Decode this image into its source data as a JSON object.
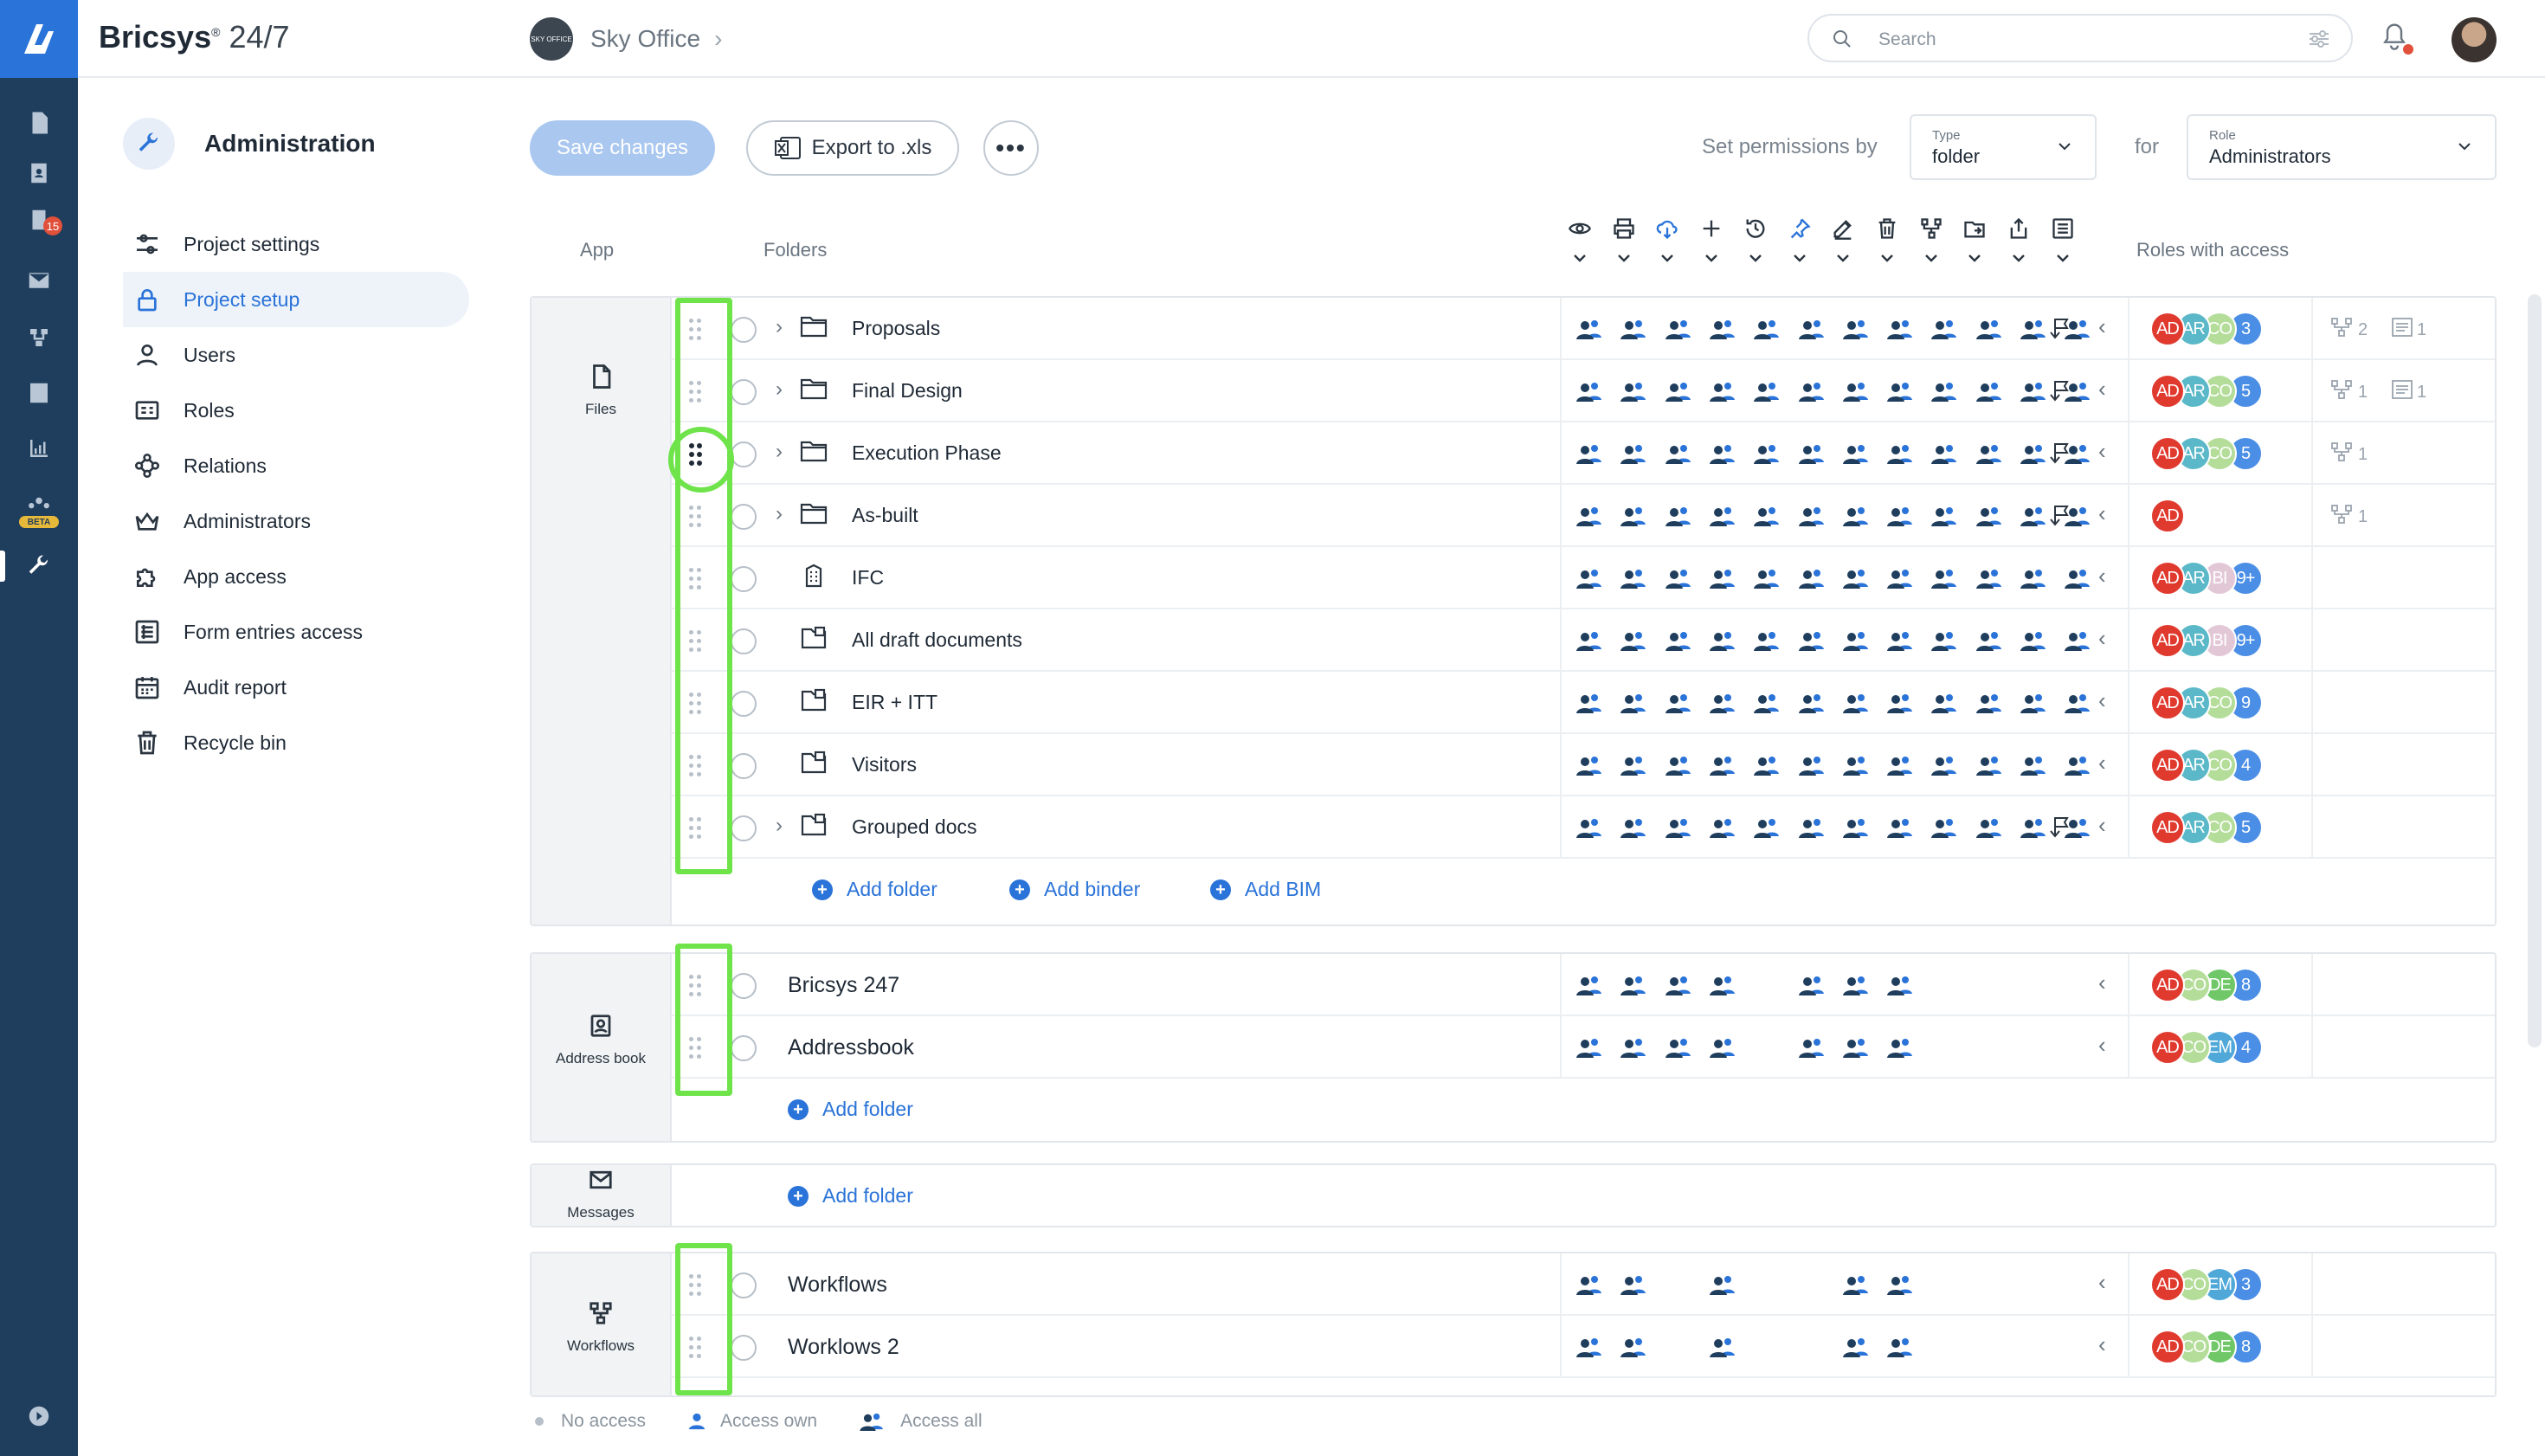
{
  "app": {
    "brand": "Bricsys",
    "brand_sup": "®",
    "brand_version": "24/7"
  },
  "project": {
    "logo_text": "SKY OFFICE",
    "name": "Sky Office",
    "chevron": "›"
  },
  "search": {
    "placeholder": "Search"
  },
  "admin": {
    "title": "Administration"
  },
  "nav": [
    {
      "label": "Project settings",
      "icon": "sliders-icon"
    },
    {
      "label": "Project setup",
      "icon": "lock-icon",
      "active": true
    },
    {
      "label": "Users",
      "icon": "user-icon"
    },
    {
      "label": "Roles",
      "icon": "id-card-icon"
    },
    {
      "label": "Relations",
      "icon": "relations-icon"
    },
    {
      "label": "Administrators",
      "icon": "crown-icon"
    },
    {
      "label": "App access",
      "icon": "puzzle-icon"
    },
    {
      "label": "Form entries access",
      "icon": "form-icon"
    },
    {
      "label": "Audit report",
      "icon": "calendar-icon"
    },
    {
      "label": "Recycle bin",
      "icon": "trash-icon"
    }
  ],
  "rail": {
    "messages_badge": "15",
    "beta_label": "BETA"
  },
  "toolbar": {
    "save_label": "Save changes",
    "export_label": "Export to .xls",
    "more_label": "•••",
    "set_permissions_label": "Set permissions by",
    "type_select": {
      "label": "Type",
      "value": "folder"
    },
    "for_label": "for",
    "role_select": {
      "label": "Role",
      "value": "Administrators"
    }
  },
  "columns": {
    "app": "App",
    "folders": "Folders",
    "roles": "Roles with access"
  },
  "permission_icons": [
    "view-icon",
    "print-icon",
    "download-icon",
    "add-icon",
    "history-icon",
    "pin-icon",
    "edit-icon",
    "delete-icon",
    "workflow-icon",
    "move-icon",
    "share-icon",
    "form-icon"
  ],
  "sections": [
    {
      "app": "Files",
      "rows": [
        {
          "name": "Proposals",
          "type": "folder",
          "expandable": true,
          "flag": true,
          "roles": [
            "AD",
            "AR",
            "CO",
            "3"
          ],
          "relations": "2",
          "forms": "1"
        },
        {
          "name": "Final Design",
          "type": "folder",
          "expandable": true,
          "flag": true,
          "roles": [
            "AD",
            "AR",
            "CO",
            "5"
          ],
          "relations": "1",
          "forms": "1"
        },
        {
          "name": "Execution Phase",
          "type": "folder",
          "expandable": true,
          "flag": true,
          "dragging": true,
          "roles": [
            "AD",
            "AR",
            "CO",
            "5"
          ],
          "relations": "1"
        },
        {
          "name": "As-built",
          "type": "folder",
          "expandable": true,
          "flag": true,
          "roles": [
            "AD"
          ],
          "relations": "1"
        },
        {
          "name": "IFC",
          "type": "bim",
          "roles": [
            "AD",
            "AR",
            "BI",
            "9+"
          ]
        },
        {
          "name": "All draft documents",
          "type": "binder",
          "roles": [
            "AD",
            "AR",
            "BI",
            "9+"
          ]
        },
        {
          "name": "EIR + ITT",
          "type": "binder",
          "roles": [
            "AD",
            "AR",
            "CO",
            "9"
          ]
        },
        {
          "name": "Visitors",
          "type": "binder",
          "roles": [
            "AD",
            "AR",
            "CO",
            "4"
          ]
        },
        {
          "name": "Grouped docs",
          "type": "binder",
          "expandable": true,
          "flag": true,
          "roles": [
            "AD",
            "AR",
            "CO",
            "5"
          ]
        }
      ],
      "add_links": [
        "Add folder",
        "Add binder",
        "Add BIM"
      ]
    },
    {
      "app": "Address book",
      "rows": [
        {
          "name": "Bricsys 247",
          "roles": [
            "AD",
            "CO",
            "DE",
            "8"
          ]
        },
        {
          "name": "Addressbook",
          "roles": [
            "AD",
            "CO",
            "EM",
            "4"
          ]
        }
      ],
      "add_links": [
        "Add folder"
      ]
    },
    {
      "app": "Messages",
      "rows": [],
      "add_links": [
        "Add folder"
      ]
    },
    {
      "app": "Workflows",
      "rows": [
        {
          "name": "Workflows",
          "roles": [
            "AD",
            "CO",
            "EM",
            "3"
          ]
        },
        {
          "name": "Worklows 2",
          "roles": [
            "AD",
            "CO",
            "DE",
            "8"
          ]
        }
      ]
    }
  ],
  "legend": {
    "no_access": "No access",
    "access_own": "Access own",
    "access_all": "Access all"
  },
  "colors": {
    "accent": "#2a73d8",
    "rail": "#1f3d5c",
    "highlight": "#6ee34a",
    "AD": "#e03a2f",
    "AR": "#5ab8c8",
    "CO": "#b4dd9a",
    "BI": "#e2c7d6",
    "DE": "#6fc767",
    "EM": "#4fa8d8",
    "count": "#4a8ee6"
  }
}
